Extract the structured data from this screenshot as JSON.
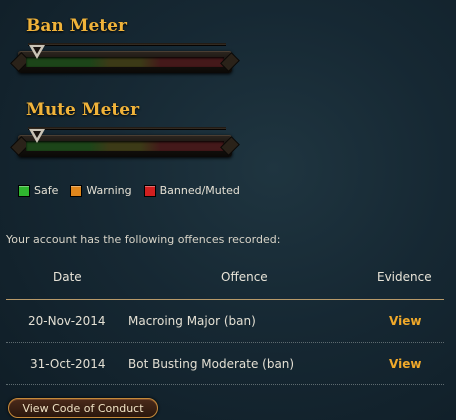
{
  "ban_meter": {
    "title": "Ban Meter",
    "level": 0
  },
  "mute_meter": {
    "title": "Mute Meter",
    "level": 0
  },
  "legend": [
    {
      "label": "Safe",
      "color": "#2fb52f"
    },
    {
      "label": "Warning",
      "color": "#e0861c"
    },
    {
      "label": "Banned/Muted",
      "color": "#d11f1f"
    }
  ],
  "intro_text": "Your account has the following offences recorded:",
  "table": {
    "headers": {
      "date": "Date",
      "offence": "Offence",
      "evidence": "Evidence"
    },
    "rows": [
      {
        "date": "20-Nov-2014",
        "offence": "Macroing Major (ban)",
        "evidence": "View"
      },
      {
        "date": "31-Oct-2014",
        "offence": "Bot Busting Moderate (ban)",
        "evidence": "View"
      }
    ]
  },
  "code_of_conduct_button": "View Code of Conduct"
}
